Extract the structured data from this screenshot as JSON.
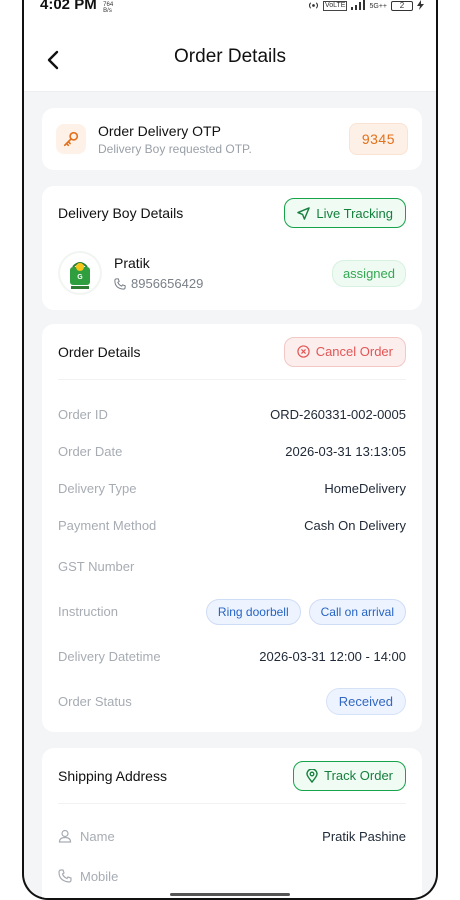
{
  "status_bar": {
    "time": "4:02 PM",
    "net_speed_top": "764",
    "net_speed_unit": "B/s",
    "vo_label": "VoLTE",
    "network": "5G++",
    "battery": "2"
  },
  "header": {
    "title": "Order Details"
  },
  "otp": {
    "title": "Order Delivery OTP",
    "subtitle": "Delivery Boy requested OTP.",
    "code": "9345"
  },
  "delivery_boy": {
    "section_title": "Delivery Boy Details",
    "live_tracking_label": "Live Tracking",
    "name": "Pratik",
    "phone": "8956656429",
    "status": "assigned"
  },
  "order_details": {
    "section_title": "Order Details",
    "cancel_label": "Cancel Order",
    "rows": [
      {
        "label": "Order ID",
        "value": "ORD-260331-002-0005"
      },
      {
        "label": "Order Date",
        "value": "2026-03-31 13:13:05"
      },
      {
        "label": "Delivery Type",
        "value": "HomeDelivery"
      },
      {
        "label": "Payment Method",
        "value": "Cash On Delivery"
      },
      {
        "label": "GST Number",
        "value": ""
      }
    ],
    "instruction_label": "Instruction",
    "instructions": [
      "Ring doorbell",
      "Call on arrival"
    ],
    "delivery_datetime_label": "Delivery Datetime",
    "delivery_datetime": "2026-03-31 12:00 - 14:00",
    "order_status_label": "Order Status",
    "order_status": "Received"
  },
  "shipping": {
    "section_title": "Shipping Address",
    "track_label": "Track Order",
    "name_label": "Name",
    "name": "Pratik Pashine",
    "mobile_label": "Mobile"
  },
  "colors": {
    "accent_orange": "#e2711d",
    "accent_green": "#16a34a",
    "accent_red": "#e25555",
    "accent_blue": "#2563c4"
  },
  "icons": {
    "back": "arrow-left-icon",
    "otp": "key-icon",
    "live_tracking": "navigation-arrow-icon",
    "phone": "phone-icon",
    "cancel": "x-circle-icon",
    "track": "map-pin-icon",
    "user": "user-icon"
  }
}
